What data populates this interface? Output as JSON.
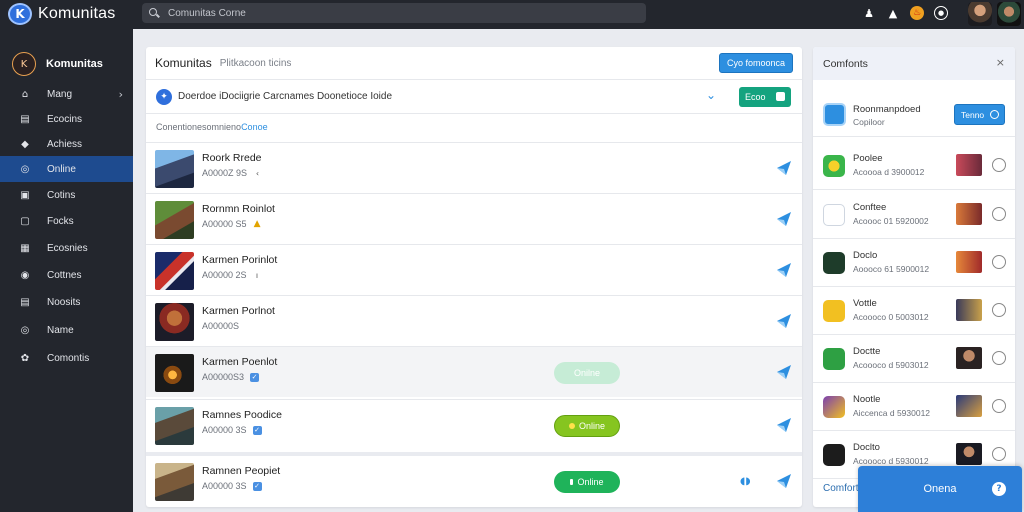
{
  "app": {
    "name": "Komunitas",
    "logo_letter": "K"
  },
  "search": {
    "text": "Comunitas Corne"
  },
  "top_icons": [
    "person-icon",
    "bell-icon",
    "flame-icon",
    "settings-icon"
  ],
  "sidebar": {
    "header": "Komunitas",
    "items": [
      {
        "label": "Mang",
        "icon": "home-icon",
        "glyph": "⌂",
        "chevron": "›"
      },
      {
        "label": "Ecocins",
        "icon": "list-icon",
        "glyph": "▤"
      },
      {
        "label": "Achiess",
        "icon": "tag-icon",
        "glyph": "◆"
      },
      {
        "label": "Online",
        "icon": "online-icon",
        "glyph": "◎",
        "active": true
      },
      {
        "label": "Cotins",
        "icon": "box-icon",
        "glyph": "▣"
      },
      {
        "label": "Focks",
        "icon": "book-icon",
        "glyph": "▢"
      },
      {
        "label": "Ecosnies",
        "icon": "grid-icon",
        "glyph": "▦"
      },
      {
        "label": "Cottnes",
        "icon": "globe-icon",
        "glyph": "◉"
      },
      {
        "label": "Noosits",
        "icon": "doc-icon",
        "glyph": "▤"
      },
      {
        "label": "Name",
        "icon": "target-icon",
        "glyph": "◎"
      },
      {
        "label": "Comontis",
        "icon": "users-icon",
        "glyph": "✿"
      }
    ]
  },
  "main": {
    "title": "Komunitas",
    "subtitle": "Plitkacoon ticins",
    "primary_button": "Cyo fomoonca",
    "filter_text": "Doerdoe iDociigrie Carcnames Doonetioce Ioide",
    "filter_button": "Ecoo",
    "section_label": "Conentionesomnieno",
    "section_label_highlight": "Conoe",
    "rows": [
      {
        "name": "Roork Rrede",
        "meta": "A0000Z 9S",
        "badge": "‹",
        "badge_kind": "small",
        "pill": "",
        "pill_kind": ""
      },
      {
        "name": "Rornmn Roinlot",
        "meta": "A00000 S5",
        "badge": "▲",
        "badge_kind": "gold",
        "pill": "",
        "pill_kind": ""
      },
      {
        "name": "Karmen Porinlot",
        "meta": "A00000 2S",
        "badge": "ı",
        "badge_kind": "small",
        "pill": "",
        "pill_kind": ""
      },
      {
        "name": "Karmen Porlnot",
        "meta": "A00000S",
        "badge": "",
        "badge_kind": "",
        "pill": "",
        "pill_kind": ""
      },
      {
        "name": "Karmen Poenlot",
        "meta": "A00000S3",
        "badge": "✓",
        "badge_kind": "blue",
        "pill": "Onilne",
        "pill_kind": "faded"
      },
      {
        "name": "Ramnes Poodice",
        "meta": "A00000 3S",
        "badge": "✓",
        "badge_kind": "blue",
        "pill": "Online",
        "pill_kind": "lime"
      },
      {
        "name": "Ramnen Peopiet",
        "meta": "A00000 3S",
        "badge": "✓",
        "badge_kind": "blue",
        "pill": "Online",
        "pill_kind": "green",
        "extra": "◖◗"
      }
    ]
  },
  "right_panel": {
    "title": "Comfonts",
    "close": "×",
    "feature": {
      "title": "Roonmanpdoed",
      "subtitle": "Copiloor",
      "button": "Tenno"
    },
    "items": [
      {
        "title": "Poolee",
        "sub": "Acoooa d 3900012",
        "icon_color": "#3ab54a"
      },
      {
        "title": "Conftee",
        "sub": "Acoooc 01 5920002",
        "icon_color": "#ffffff"
      },
      {
        "title": "Doclo",
        "sub": "Aoooco 61 5900012",
        "icon_color": "#1e3c2a"
      },
      {
        "title": "Vottle",
        "sub": "Acoooco 0 5003012",
        "icon_color": "#f2c021"
      },
      {
        "title": "Doctte",
        "sub": "Acoooco d 5903012",
        "icon_color": "#2ea043"
      },
      {
        "title": "Nootle",
        "sub": "Aiccenca d 5930012",
        "icon_color": "#7a3fb0"
      },
      {
        "title": "Doclto",
        "sub": "Acoooco d 5930012",
        "icon_color": "#1c1c1c"
      }
    ],
    "footer": "Comfortis"
  },
  "bottom_button": {
    "label": "Onena",
    "help": "?"
  },
  "colors": {
    "accent": "#2d8fe0",
    "sidebar": "#23262d",
    "active": "#1e4b8f",
    "green": "#1fb35a"
  }
}
